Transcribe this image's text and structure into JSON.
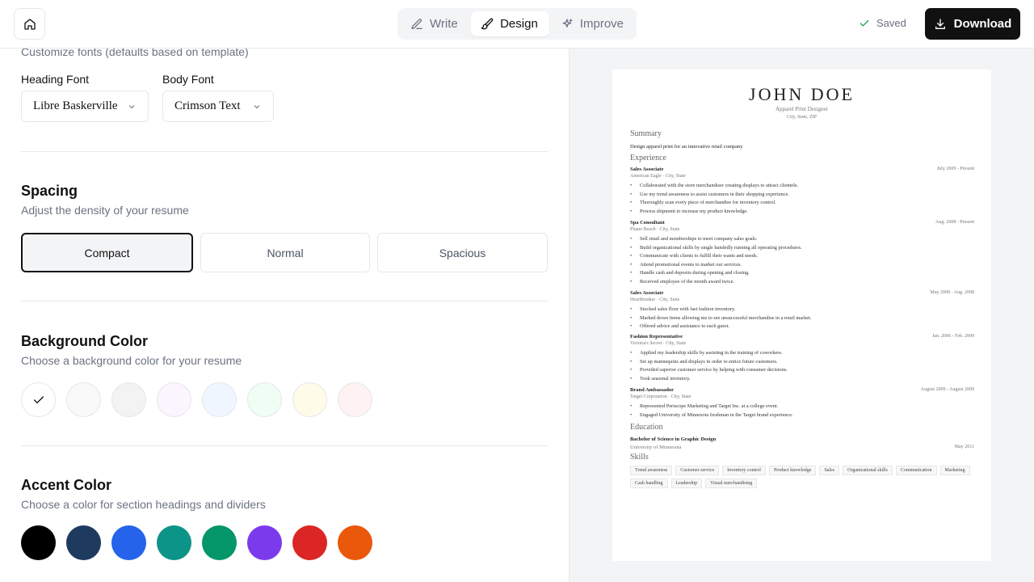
{
  "header": {
    "tabs": [
      {
        "label": "Write"
      },
      {
        "label": "Design"
      },
      {
        "label": "Improve"
      }
    ],
    "saved_label": "Saved",
    "download_label": "Download"
  },
  "fonts": {
    "description": "Customize fonts (defaults based on template)",
    "heading_label": "Heading Font",
    "heading_value": "Libre Baskerville",
    "body_label": "Body Font",
    "body_value": "Crimson Text"
  },
  "spacing": {
    "title": "Spacing",
    "description": "Adjust the density of your resume",
    "options": [
      "Compact",
      "Normal",
      "Spacious"
    ],
    "selected": "Compact"
  },
  "background": {
    "title": "Background Color",
    "description": "Choose a background color for your resume",
    "colors": [
      "#ffffff",
      "#f9f9f9",
      "#f3f3f3",
      "#faf5ff",
      "#eff6ff",
      "#f0fdf4",
      "#fefce8",
      "#fef2f2"
    ],
    "selected_index": 0
  },
  "accent": {
    "title": "Accent Color",
    "description": "Choose a color for section headings and dividers",
    "colors": [
      "#000000",
      "#1e3a5f",
      "#2563eb",
      "#0d9488",
      "#059669",
      "#7c3aed",
      "#dc2626",
      "#ea580c"
    ]
  },
  "resume": {
    "name": "JOHN DOE",
    "title": "Apparel Print Designer",
    "location": "City, State, ZIP",
    "summary_heading": "Summary",
    "summary": "Design apparel print for an innovative retail company",
    "experience_heading": "Experience",
    "jobs": [
      {
        "role": "Sales Associate",
        "company": "American Eagle · City, State",
        "dates": "July 2009 - Present",
        "bullets": [
          "Collaborated with the store merchandiser creating displays to attract clientele.",
          "Use my trend awareness to assist customers in their shopping experience.",
          "Thoroughly scan every piece of merchandise for inventory control.",
          "Process shipment to increase my product knowledge."
        ]
      },
      {
        "role": "Spa Consultant",
        "company": "Planet Beach · City, State",
        "dates": "Aug. 2008 - Present",
        "bullets": [
          "Sell retail and memberships to meet company sales goals.",
          "Build organizational skills by single handedly running all operating procedures.",
          "Communicate with clients to fulfill their wants and needs.",
          "Attend promotional events to market our services.",
          "Handle cash and deposits during opening and closing.",
          "Received employee of the month award twice."
        ]
      },
      {
        "role": "Sales Associate",
        "company": "Heartbreaker · City, State",
        "dates": "May 2008 - Aug. 2008",
        "bullets": [
          "Stocked sales floor with fast fashion inventory.",
          "Marked down items allowing me to see unsuccessful merchandise in a retail market.",
          "Offered advice and assistance to each guest."
        ]
      },
      {
        "role": "Fashion Representative",
        "company": "Victoria's Secret · City, State",
        "dates": "Jan. 2006 - Feb. 2009",
        "bullets": [
          "Applied my leadership skills by assisting in the training of coworkers.",
          "Set up mannequins and displays in order to entice future customers.",
          "Provided superior customer service by helping with consumer decisions.",
          "Took seasonal inventory."
        ]
      },
      {
        "role": "Brand Ambassador",
        "company": "Target Corporation · City, State",
        "dates": "August 2009 - August 2009",
        "bullets": [
          "Represented Periscope Marketing and Target Inc. at a college event.",
          "Engaged University of Minnesota freshman in the Target brand experience."
        ]
      }
    ],
    "education_heading": "Education",
    "degree": "Bachelor of Science in Graphic Design",
    "school": "University of Minnesota",
    "grad_date": "May 2011",
    "skills_heading": "Skills",
    "skills": [
      "Trend awareness",
      "Customer service",
      "Inventory control",
      "Product knowledge",
      "Sales",
      "Organizational skills",
      "Communication",
      "Marketing",
      "Cash handling",
      "Leadership",
      "Visual merchandising"
    ]
  }
}
